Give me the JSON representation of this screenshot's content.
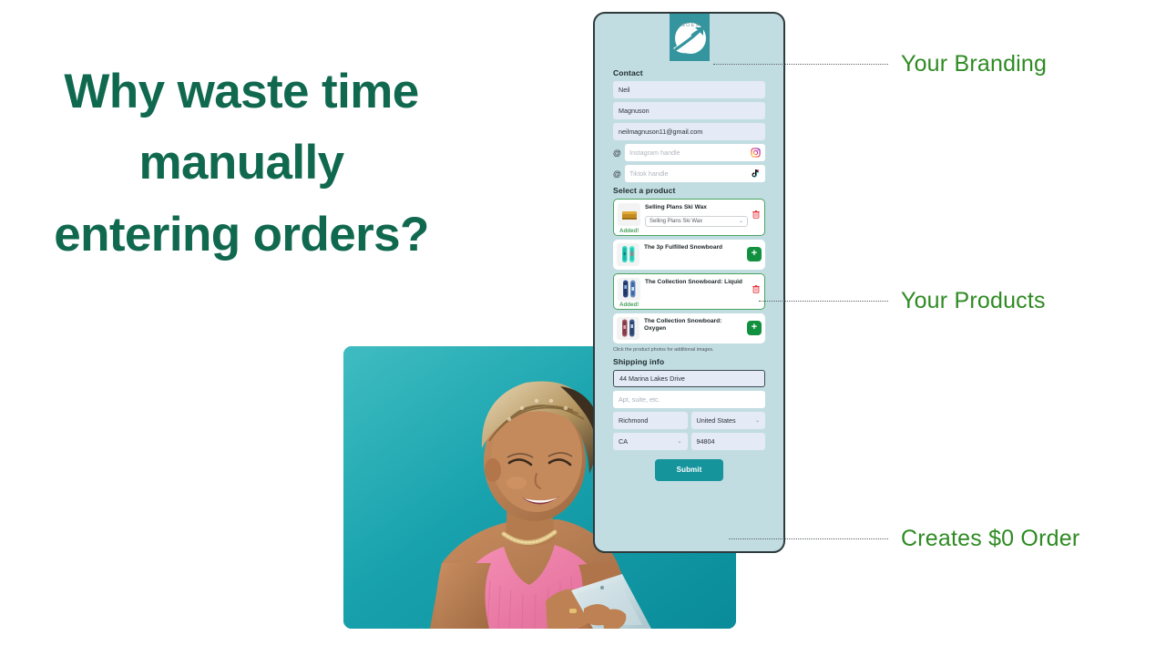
{
  "headline": {
    "lines": [
      "Why waste time",
      "manually",
      "entering orders?"
    ],
    "color": "#10694f"
  },
  "annotations": [
    {
      "id": "branding",
      "label": "Your Branding",
      "color": "#2e8b22"
    },
    {
      "id": "products",
      "label": "Your Products",
      "color": "#2e8b22"
    },
    {
      "id": "order",
      "label": "Creates $0 Order",
      "color": "#2e8b22"
    }
  ],
  "form": {
    "panel_bg": "#c2dde2",
    "logo": {
      "icon": "goes-logo-icon",
      "wordmark": "GOES",
      "bg": "#35959e"
    },
    "contact": {
      "title": "Contact",
      "first_name": "Neil",
      "last_name": "Magnuson",
      "email": "neilmagnuson11@gmail.com",
      "instagram_placeholder": "Instagram handle",
      "instagram_value": "",
      "tiktok_placeholder": "Tiktok handle",
      "tiktok_value": "",
      "at_symbol": "@"
    },
    "products": {
      "title": "Select a product",
      "helper": "Click the product photos for additional images.",
      "added_label": "Added!",
      "plus_label": "+",
      "items": [
        {
          "name": "Selling Plans Ski Wax",
          "thumb": "ski-wax-thumb",
          "added": true,
          "variant": "Selling Plans Ski Wax",
          "has_variant_select": true,
          "action": "remove"
        },
        {
          "name": "The 3p Fulfilled Snowboard",
          "thumb": "snowboard-teal-thumb",
          "added": false,
          "variant": "",
          "has_variant_select": false,
          "action": "add"
        },
        {
          "name": "The Collection Snowboard: Liquid",
          "thumb": "snowboard-blue-thumb",
          "added": true,
          "variant": "",
          "has_variant_select": false,
          "action": "remove"
        },
        {
          "name": "The Collection Snowboard: Oxygen",
          "thumb": "snowboard-red-thumb",
          "added": false,
          "variant": "",
          "has_variant_select": false,
          "action": "add"
        }
      ]
    },
    "shipping": {
      "title": "Shipping info",
      "address1": "44 Marina Lakes Drive",
      "address2_placeholder": "Apt, suite, etc.",
      "address2_value": "",
      "city": "Richmond",
      "country": "United States",
      "state": "CA",
      "zip": "94804"
    },
    "submit_label": "Submit",
    "submit_color": "#16949c"
  }
}
